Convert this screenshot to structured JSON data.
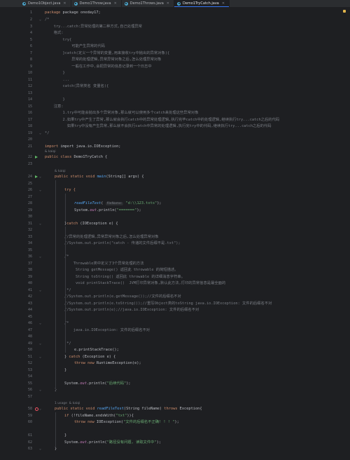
{
  "tabs": [
    {
      "label": "Demo1Object.java",
      "active": false
    },
    {
      "label": "Demo1Throw.java",
      "active": false
    },
    {
      "label": "Demo1Throws.java",
      "active": false
    },
    {
      "label": "Demo1TryCatch.java",
      "active": true
    }
  ],
  "icons": {
    "java": "java-class-icon",
    "close": "close-icon",
    "run": "run-gutter-icon",
    "breakpoint": "breakpoint-icon"
  },
  "colors": {
    "background": "#1e1f22",
    "keyword": "#cf8e6d",
    "string": "#6aab73",
    "comment": "#7a7e85",
    "method": "#56a8f5",
    "field": "#c77dbb"
  },
  "lines": {
    "l1": "package oneday17;",
    "l2": "/*",
    "l3": "    try...catch:异常处理的第二种方式,自己处理异常",
    "l4": "    格式:",
    "l5": "        try{",
    "l6": "            可能产生异常的代码",
    "l7": "        }catch(定义一个异常的变量,用来接收try中抛出的异常对象){",
    "l8": "            异常的处理逻辑,异常异常对象之后,怎么处理异常对象",
    "l9": "            一般在工作中,会把异常的信息记录到一个日志中",
    "l10": "        }",
    "l11": "        ...",
    "l12": "        catch(异常类名 变量名){",
    "l13": "",
    "l14": "        }",
    "l15": "    注意:",
    "l16": "        1.try中可能会抛出多个异常对象,那么就可以使用多个catch来处理这些异常对象",
    "l17": "        2.如果try中产生了异常,那么就会执行catch中的异常处理逻辑,执行完毕catch中的处理逻辑,继续执行try...catch之后的代码",
    "l18": "          如果try中没有产生异常,那么就不会执行catch中异常的处理逻辑,执行完try中的代码,继续执行try...catch之后的代码",
    "l19": "*/",
    "l21": "import java.io.IOException;",
    "author": "& kaiqi",
    "l22_kw": "public class",
    "l22_name": "Demo1TryCatch",
    "l22_end": "{",
    "l24_kw": "public static void",
    "l24_m": "main",
    "l24_end": "(String[] args) {",
    "l26": "try {",
    "l28_m": "readFileTest",
    "l28_hint": "fileName:",
    "l28_s": "\"d:\\\\123.txts\"",
    "l28_end": ");",
    "l29_a": "System.",
    "l29_out": "out",
    "l29_b": ".println(",
    "l29_s": "\"=======\"",
    "l29_c": ");",
    "l31": "}catch (IOException e) {",
    "l33": "//异常的处理逻辑,异常异常对象之后,怎么处理异常对象",
    "l34": "//System.out.println(\"catch - 传递的文件后缀不是.txt\");",
    "l36": "/*",
    "l37": "    Throwable类中定义了3个异常处理的方法",
    "l38": "     String getMessage() 返回此 throwable 的简短描述。",
    "l39": "     String toString() 返回此 throwable 的详细消息字符串。",
    "l40": "     void printStackTrace()  JVM打印异常对象,默认此方法,打印的异常信息是最全面的",
    "l41": " */",
    "l42": "//System.out.println(e.getMessage());//文件的后缀名不对",
    "l43": "//System.out.println(e.toString());//重写Object类的toString java.io.IOException: 文件的后缀名不对",
    "l44": "//System.out.println(e);//java.io.IOException: 文件的后缀名不对",
    "l46": "/*",
    "l47": "    java.io.IOException: 文件的后缀名不对",
    "l49": " */",
    "l50": "e.printStackTrace();",
    "l51_a": "} catch (Exception e) {",
    "l52_kw": "throw new",
    "l52_b": "RuntimeException(e);",
    "l53": "}",
    "l55_a": "System.",
    "l55_out": "out",
    "l55_b": ".println(",
    "l55_s": "\"后续代码\"",
    "l55_c": ");",
    "l56": "}",
    "usage": "1 usage  & kaiqi",
    "l58_kw": "public static void",
    "l58_m": "readFileTest",
    "l58_b": "(String fileName)",
    "l58_kw2": "throws",
    "l58_c": "Exception{",
    "l59_kw": "if",
    "l59_b": "(!fileName.endsWith(",
    "l59_s": "\"txt\"",
    "l59_c": ")){",
    "l60_kw": "throw new",
    "l60_b": "IOException(",
    "l60_s": "\"文件的后缀名不正确! ! ! \"",
    "l60_c": ");",
    "l61": "}",
    "l62_a": "System.",
    "l62_out": "out",
    "l62_b": ".println(",
    "l62_s": "\"路径没有问题, 读取文件中\"",
    "l62_c": ");",
    "l63": "}"
  },
  "line_numbers": [
    "1",
    "2",
    "3",
    "4",
    "5",
    "6",
    "7",
    "8",
    "9",
    "10",
    "11",
    "12",
    "13",
    "14",
    "15",
    "16",
    "17",
    "18",
    "19",
    "20",
    "21",
    "22",
    "23",
    "24",
    "25",
    "26",
    "27",
    "28",
    "29",
    "30",
    "31",
    "32",
    "33",
    "34",
    "35",
    "36",
    "37",
    "38",
    "39",
    "40",
    "41",
    "42",
    "43",
    "44",
    "45",
    "46",
    "47",
    "48",
    "49",
    "50",
    "51",
    "52",
    "53",
    "54",
    "55",
    "56",
    "57",
    "58",
    "59",
    "60",
    "61",
    "62",
    "63"
  ]
}
